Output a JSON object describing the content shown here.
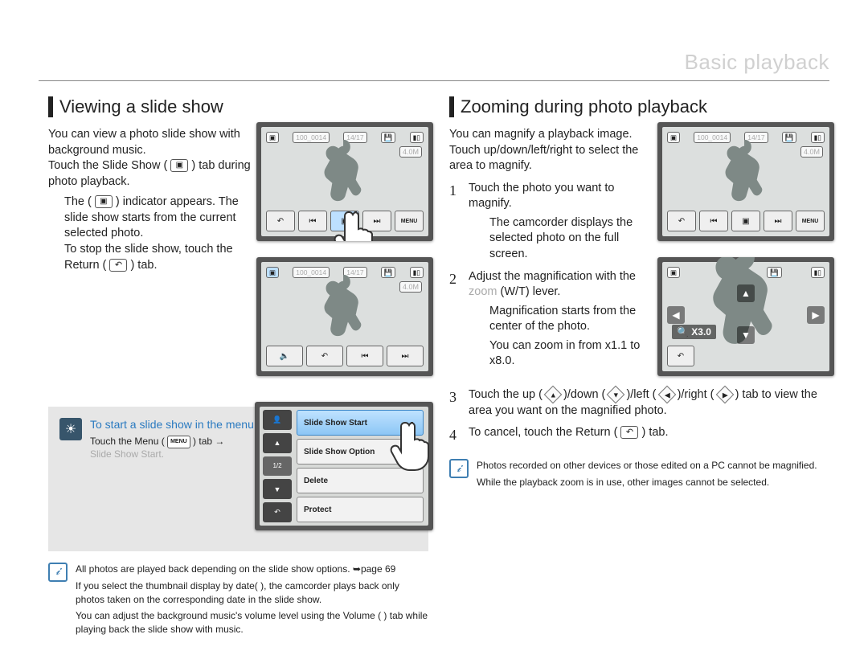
{
  "chapter": "Basic playback",
  "left": {
    "title": "Viewing a slide show",
    "intro1": "You can view a photo slide show with background music.",
    "intro2a": "Touch the Slide Show (",
    "intro2b": ") tab during photo playback.",
    "bullet1a": "The (",
    "bullet1b": ") indicator appears. The slide show starts from the current selected photo.",
    "bullet2a": "To stop the slide show, touch the Return (",
    "bullet2b": ") tab.",
    "tip_heading": "To start a slide show in the menu screen",
    "tip_line": "Touch the Menu (",
    "tip_line_end": ") tab →",
    "tip_line2": "Slide Show Start.",
    "menu_items": {
      "item0": "Slide Show Start",
      "item1": "Slide Show Option",
      "item2": "Delete",
      "item3": "Protect"
    },
    "sidebar_counter": "1/2",
    "note1": "All photos are played back depending on the slide show options. ➥page 69",
    "note2": "If you select the thumbnail display by date(      ), the camcorder plays back only photos taken on the corresponding date in the slide show.",
    "note3": "You can adjust the background music's volume level using the Volume (       ) tab while playing back the slide show with music.",
    "lcd1": {
      "file": "100_0014",
      "counter": "14/17",
      "res": "4.0M"
    },
    "lcd2": {
      "file": "100_0014",
      "counter": "14/17",
      "res": "4.0M"
    }
  },
  "right": {
    "title": "Zooming during photo playback",
    "intro1": "You can magnify a playback image. Touch up/down/left/right to select the area to magnify.",
    "step1": "Touch the photo you want to magnify.",
    "step1_sub": "The camcorder displays the selected photo on the full screen.",
    "step2a": "Adjust the magnification with the ",
    "step2_zoom_label": "zoom",
    "step2b": " (W/T) lever.",
    "step2_sub1": "Magnification starts from the center of the photo.",
    "step2_sub2": "You can zoom in from x1.1 to x8.0.",
    "step3a": "Touch the up (",
    "step3b": ")/down (",
    "step3c": ")/left (",
    "step3d": ")/right (",
    "step3e": ") tab to view the area you want on the magnified photo.",
    "step4a": "To cancel, touch the Return (",
    "step4b": ") tab.",
    "note1": "Photos recorded on other devices or those edited on a PC cannot be magnified.",
    "note2": "While the playback zoom is in use, other images cannot be selected.",
    "lcd1": {
      "file": "100_0014",
      "counter": "14/17",
      "res": "4.0M"
    },
    "lcd2": {
      "zoom": "X3.0"
    }
  }
}
